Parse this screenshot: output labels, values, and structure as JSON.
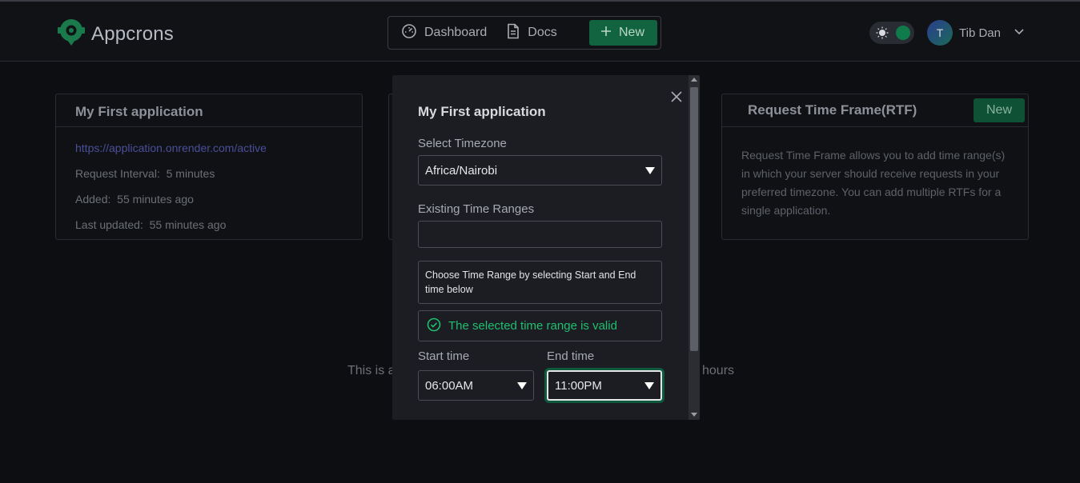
{
  "header": {
    "brand": "Appcrons",
    "nav": [
      {
        "label": "Dashboard",
        "icon": "gauge-icon"
      },
      {
        "label": "Docs",
        "icon": "document-icon"
      },
      {
        "label": "New",
        "icon": "plus-icon"
      }
    ],
    "user": {
      "initial": "T",
      "name": "Tib Dan"
    },
    "accent": "#11643f"
  },
  "app_card": {
    "title": "My First application",
    "url": "https://application.onrender.com/active",
    "interval_label": "Request Interval:",
    "interval_value": "5 minutes",
    "added_label": "Added:",
    "added_value": "55 minutes ago",
    "updated_label": "Last updated:",
    "updated_value": "55 minutes ago"
  },
  "rtf_card": {
    "title": "Request Time Frame(RTF)",
    "new_label": "New",
    "description": "Request Time Frame allows you to add time range(s) in which your server should receive requests in your preferred timezone. You can add multiple RTFs for a single application."
  },
  "background_text": {
    "left": "This is a",
    "right": "hours"
  },
  "modal": {
    "title": "My First application",
    "timezone_label": "Select Timezone",
    "timezone_value": "Africa/Nairobi",
    "existing_label": "Existing Time Ranges",
    "existing_value": "",
    "hint": "Choose Time Range by selecting Start and End time below",
    "valid_message": "The selected time range is valid",
    "start_label": "Start time",
    "start_value": "06:00AM",
    "end_label": "End time",
    "end_value": "11:00PM",
    "valid_color": "#1fbf70"
  }
}
